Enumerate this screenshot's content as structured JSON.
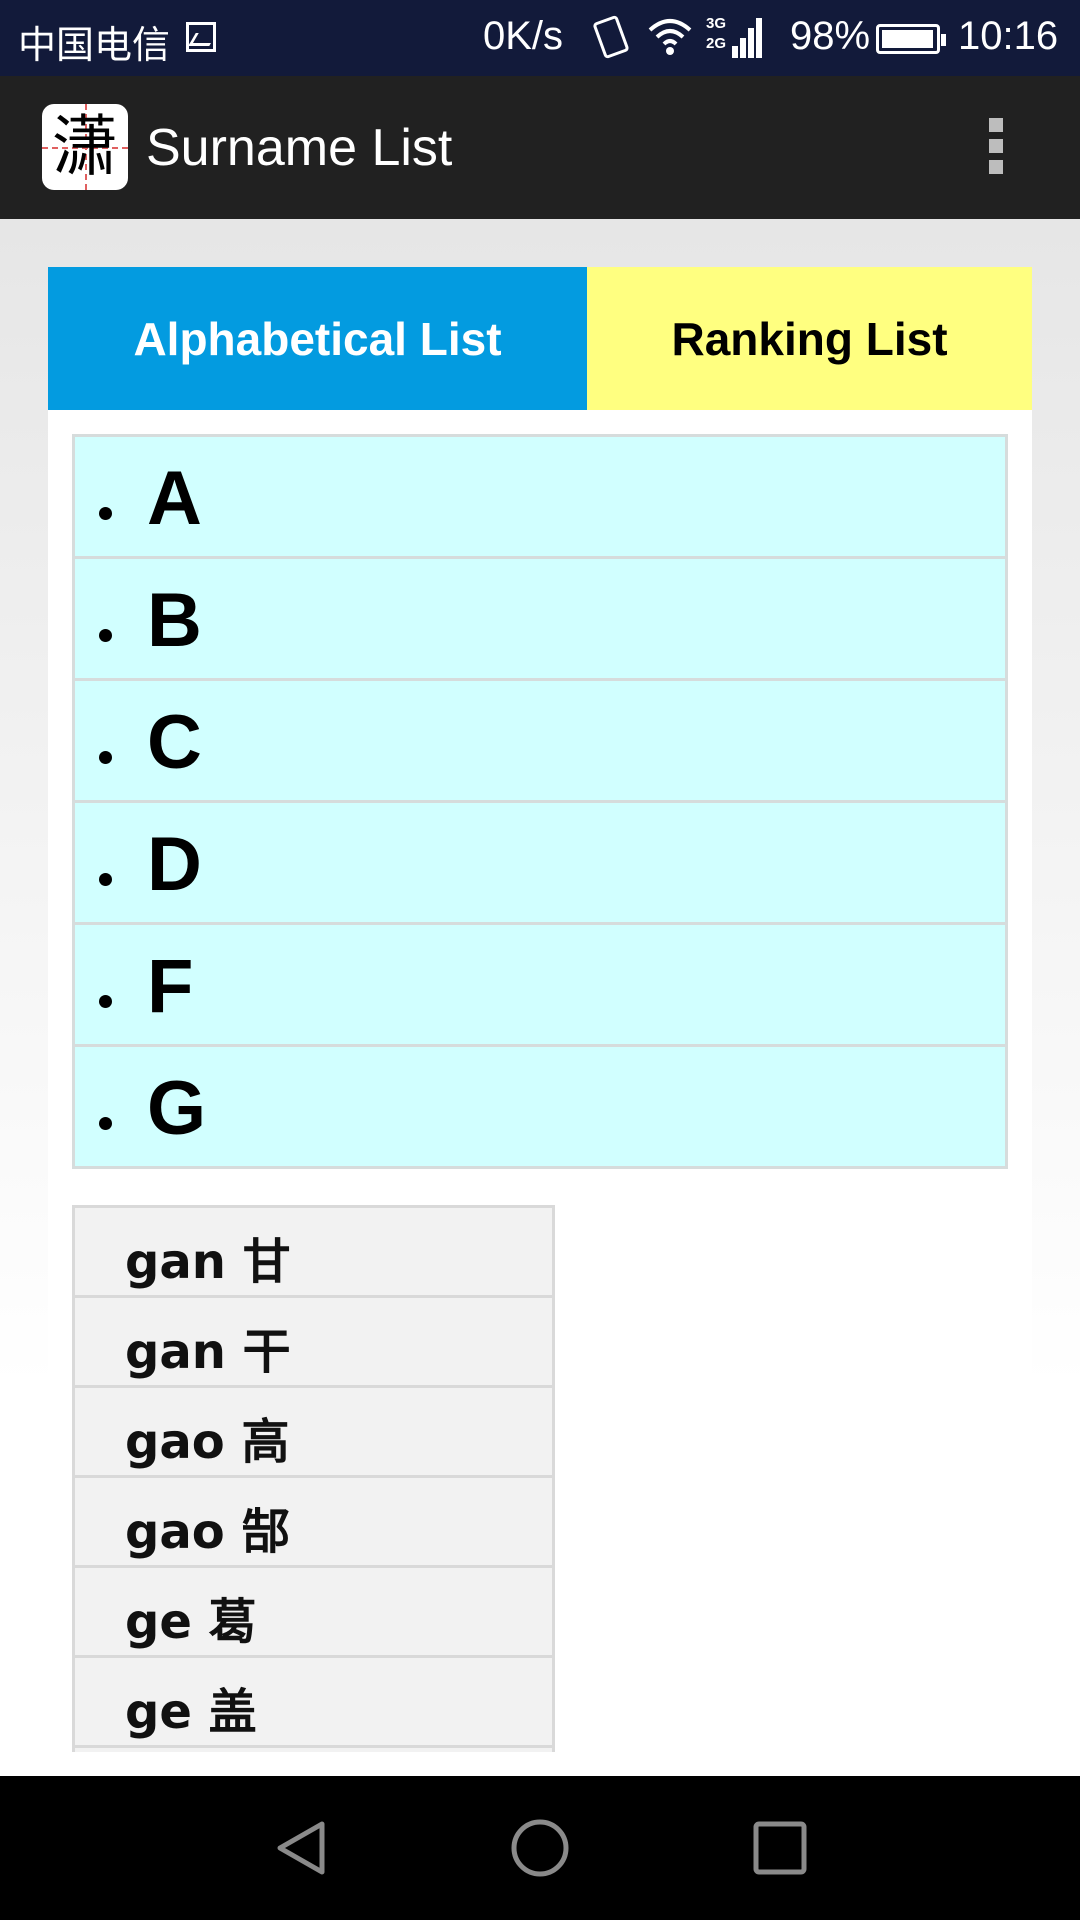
{
  "status_bar": {
    "carrier": "中国电信",
    "network_speed": "0K/s",
    "network_type_top": "3G",
    "network_type_bottom": "2G",
    "battery_percent": "98%",
    "battery_level": 0.98,
    "time": "10:16",
    "icons": [
      "gallery-icon",
      "vibrate-icon",
      "wifi-icon",
      "signal-icon",
      "battery-icon"
    ]
  },
  "app_bar": {
    "icon_glyph": "潇",
    "title": "Surname List",
    "menu_icon": "overflow-menu-icon"
  },
  "tabs": [
    {
      "label": "Alphabetical List",
      "selected": true,
      "color": "#039be0"
    },
    {
      "label": "Ranking List",
      "selected": false,
      "color": "#ffff80"
    }
  ],
  "letters": [
    {
      "label": "A"
    },
    {
      "label": "B"
    },
    {
      "label": "C"
    },
    {
      "label": "D"
    },
    {
      "label": "F"
    },
    {
      "label": "G",
      "expanded": true
    }
  ],
  "surnames": [
    {
      "label": "gan 甘"
    },
    {
      "label": "gan 干"
    },
    {
      "label": "gao 高"
    },
    {
      "label": "gao 郜"
    },
    {
      "label": "ge 葛"
    },
    {
      "label": "ge 盖"
    }
  ],
  "nav_bar": {
    "icons": [
      "back-icon",
      "home-icon",
      "recents-icon"
    ]
  },
  "colors": {
    "status_bar": "#121a3a",
    "app_bar": "#212121",
    "letter_row": "#d1ffff",
    "surname_row": "#f2f2f2"
  }
}
